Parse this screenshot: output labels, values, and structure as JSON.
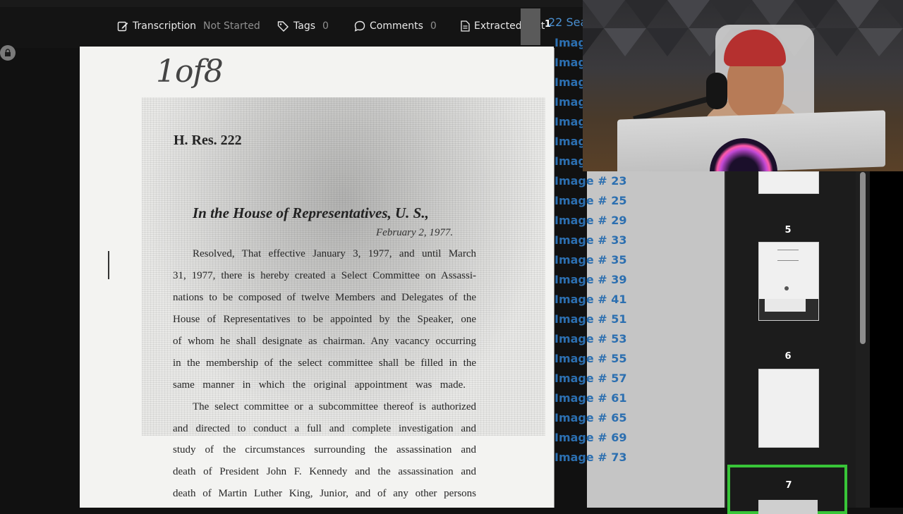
{
  "toolbar": {
    "transcription_label": "Transcription",
    "transcription_status": "Not Started",
    "tags_label": "Tags",
    "tags_count": "0",
    "comments_label": "Comments",
    "comments_count": "0",
    "extracted_label": "Extracted Text"
  },
  "document": {
    "handwritten_note": "1of8",
    "resolution_id": "H. Res. 222",
    "house_title": "In the House of Representatives, U. S.,",
    "date": "February 2, 1977.",
    "lines": [
      "Resolved, That effective January 3, 1977, and until March",
      "31, 1977, there is hereby created a Select Committee on Assassi-",
      "nations to be composed of twelve Members and Delegates of the",
      "House of Representatives to be appointed by the Speaker, one",
      "of whom he shall designate as chairman. Any vacancy occurring",
      "in the membership of the select committee shall be filled in the",
      "same manner in which the original appointment was made.",
      "The select committee or a subcommittee thereof is authorized",
      "and directed to conduct a full and complete investigation and",
      "study of the circumstances surrounding the assassination and",
      "death of President John F. Kennedy and the assassination and",
      "death of Martin Luther King, Junior, and of any other persons"
    ]
  },
  "search": {
    "results_label": "22 Sea",
    "page_badge": "1",
    "image_links": [
      "Image",
      "Image",
      "Image",
      "Image",
      "Image",
      "Image",
      "Image",
      "Image # 23",
      "Image # 25",
      "Image # 29",
      "Image # 33",
      "Image # 35",
      "Image # 39",
      "Image # 41",
      "Image # 51",
      "Image # 53",
      "Image # 55",
      "Image # 57",
      "Image # 61",
      "Image # 65",
      "Image # 69",
      "Image # 73"
    ]
  },
  "thumbnails": {
    "labels": [
      "5",
      "6",
      "7"
    ]
  },
  "colors": {
    "accent_link": "#2c6fb0",
    "selected_border": "#38c538"
  }
}
